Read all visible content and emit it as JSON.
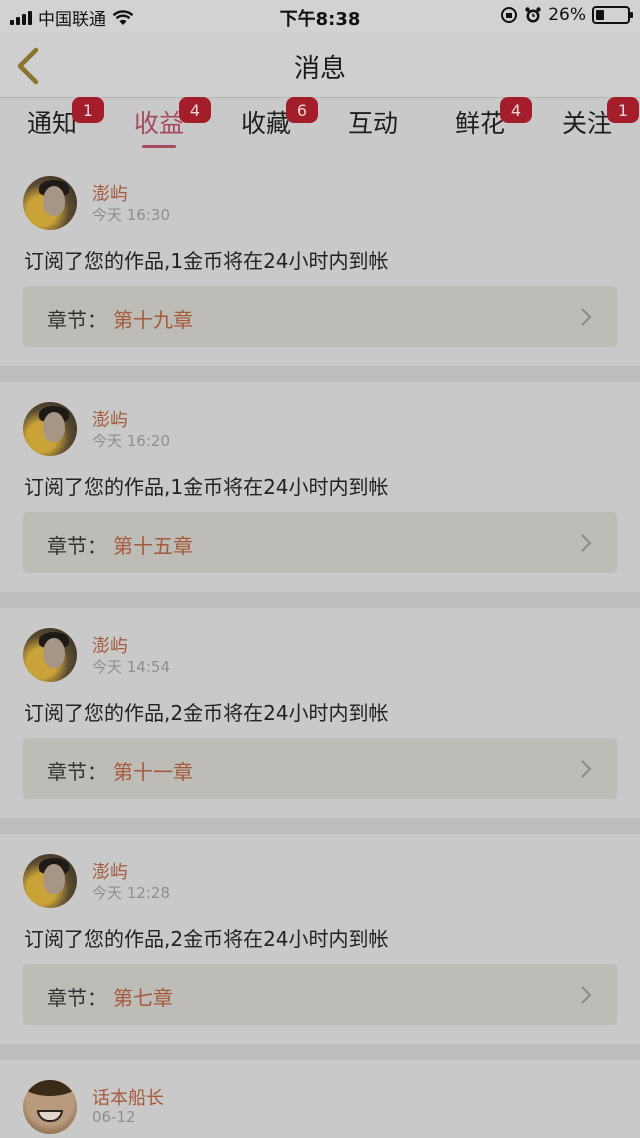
{
  "status_bar": {
    "carrier": "中国联通",
    "time": "下午8:38",
    "battery": "26%",
    "battery_level": 0.26
  },
  "nav": {
    "title": "消息"
  },
  "tabs": [
    {
      "label": "通知",
      "badge": "1",
      "active": false
    },
    {
      "label": "收益",
      "badge": "4",
      "active": true
    },
    {
      "label": "收藏",
      "badge": "6",
      "active": false
    },
    {
      "label": "互动",
      "badge": "",
      "active": false
    },
    {
      "label": "鲜花",
      "badge": "4",
      "active": false
    },
    {
      "label": "关注",
      "badge": "1",
      "active": false
    }
  ],
  "chapter_label": "章节：",
  "messages": [
    {
      "user": "澎屿",
      "time": "今天 16:30",
      "text": "订阅了您的作品,1金币将在24小时内到帐",
      "chapter": "第十九章"
    },
    {
      "user": "澎屿",
      "time": "今天 16:20",
      "text": "订阅了您的作品,1金币将在24小时内到帐",
      "chapter": "第十五章"
    },
    {
      "user": "澎屿",
      "time": "今天 14:54",
      "text": "订阅了您的作品,2金币将在24小时内到帐",
      "chapter": "第十一章"
    },
    {
      "user": "澎屿",
      "time": "今天 12:28",
      "text": "订阅了您的作品,2金币将在24小时内到帐",
      "chapter": "第七章"
    },
    {
      "user": "话本船长",
      "time": "06-12"
    }
  ]
}
